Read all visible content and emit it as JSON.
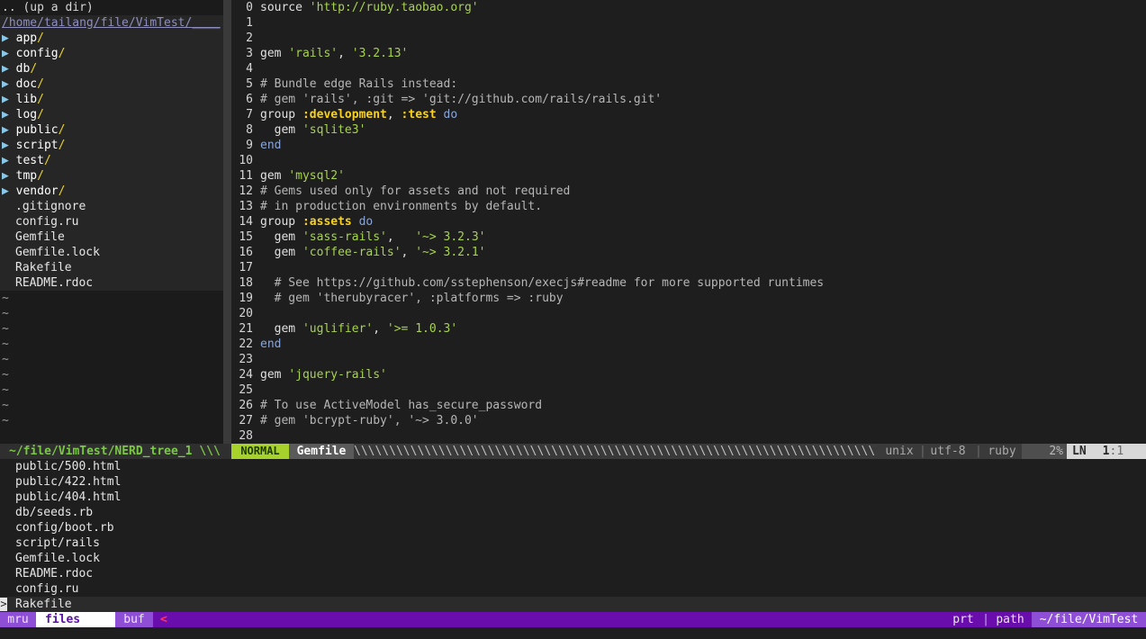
{
  "nerdtree": {
    "up_dir": ".. (up a dir)",
    "root_path": "/home/tailang/file/VimTest/",
    "dirs": [
      "app",
      "config",
      "db",
      "doc",
      "lib",
      "log",
      "public",
      "script",
      "test",
      "tmp",
      "vendor"
    ],
    "files": [
      ".gitignore",
      "config.ru",
      "Gemfile",
      "Gemfile.lock",
      "Rakefile",
      "README.rdoc"
    ],
    "arrow": "▶",
    "slash": "/",
    "tilde": "~"
  },
  "editor": {
    "lines": [
      {
        "n": "0",
        "parts": [
          [
            "plain",
            "source "
          ],
          [
            "str",
            "'http://ruby.taobao.org'"
          ]
        ]
      },
      {
        "n": "1",
        "parts": []
      },
      {
        "n": "2",
        "parts": []
      },
      {
        "n": "3",
        "parts": [
          [
            "plain",
            "gem "
          ],
          [
            "str",
            "'rails'"
          ],
          [
            "plain",
            ", "
          ],
          [
            "str",
            "'3.2.13'"
          ]
        ]
      },
      {
        "n": "4",
        "parts": []
      },
      {
        "n": "5",
        "parts": [
          [
            "cmt",
            "# Bundle edge Rails instead:"
          ]
        ]
      },
      {
        "n": "6",
        "parts": [
          [
            "cmt",
            "# gem 'rails', :git => 'git://github.com/rails/rails.git'"
          ]
        ]
      },
      {
        "n": "7",
        "parts": [
          [
            "plain",
            "group "
          ],
          [
            "sym",
            ":development"
          ],
          [
            "plain",
            ", "
          ],
          [
            "sym",
            ":test"
          ],
          [
            "plain",
            " "
          ],
          [
            "kw",
            "do"
          ]
        ]
      },
      {
        "n": "8",
        "parts": [
          [
            "plain",
            "  gem "
          ],
          [
            "str",
            "'sqlite3'"
          ]
        ]
      },
      {
        "n": "9",
        "parts": [
          [
            "kw",
            "end"
          ]
        ]
      },
      {
        "n": "10",
        "parts": []
      },
      {
        "n": "11",
        "parts": [
          [
            "plain",
            "gem "
          ],
          [
            "str",
            "'mysql2'"
          ]
        ]
      },
      {
        "n": "12",
        "parts": [
          [
            "cmt",
            "# Gems used only for assets and not required"
          ]
        ]
      },
      {
        "n": "13",
        "parts": [
          [
            "cmt",
            "# in production environments by default."
          ]
        ]
      },
      {
        "n": "14",
        "parts": [
          [
            "plain",
            "group "
          ],
          [
            "sym",
            ":assets"
          ],
          [
            "plain",
            " "
          ],
          [
            "kw",
            "do"
          ]
        ]
      },
      {
        "n": "15",
        "parts": [
          [
            "plain",
            "  gem "
          ],
          [
            "str",
            "'sass-rails'"
          ],
          [
            "plain",
            ",   "
          ],
          [
            "str",
            "'~> 3.2.3'"
          ]
        ]
      },
      {
        "n": "16",
        "parts": [
          [
            "plain",
            "  gem "
          ],
          [
            "str",
            "'coffee-rails'"
          ],
          [
            "plain",
            ", "
          ],
          [
            "str",
            "'~> 3.2.1'"
          ]
        ]
      },
      {
        "n": "17",
        "parts": []
      },
      {
        "n": "18",
        "parts": [
          [
            "cmt",
            "  # See https://github.com/sstephenson/execjs#readme for more supported runtimes"
          ]
        ]
      },
      {
        "n": "19",
        "parts": [
          [
            "cmt",
            "  # gem 'therubyracer', :platforms => :ruby"
          ]
        ]
      },
      {
        "n": "20",
        "parts": []
      },
      {
        "n": "21",
        "parts": [
          [
            "plain",
            "  gem "
          ],
          [
            "str",
            "'uglifier'"
          ],
          [
            "plain",
            ", "
          ],
          [
            "str",
            "'>= 1.0.3'"
          ]
        ]
      },
      {
        "n": "22",
        "parts": [
          [
            "kw",
            "end"
          ]
        ]
      },
      {
        "n": "23",
        "parts": []
      },
      {
        "n": "24",
        "parts": [
          [
            "plain",
            "gem "
          ],
          [
            "str",
            "'jquery-rails'"
          ]
        ]
      },
      {
        "n": "25",
        "parts": []
      },
      {
        "n": "26",
        "parts": [
          [
            "cmt",
            "# To use ActiveModel has_secure_password"
          ]
        ]
      },
      {
        "n": "27",
        "parts": [
          [
            "cmt",
            "# gem 'bcrypt-ruby', '~> 3.0.0'"
          ]
        ]
      },
      {
        "n": "28",
        "parts": []
      }
    ]
  },
  "statusline": {
    "nerd_buffer": "~/file/VimTest/NERD_tree_1 \\\\\\",
    "mode": "NORMAL",
    "filename": "Gemfile",
    "fill": "\\\\\\\\\\\\\\\\\\\\\\\\\\\\\\\\\\\\\\\\\\\\\\\\\\\\\\\\\\\\\\\\\\\\\\\\\\\\\\\\\\\\\\\\\\\\\\\\\\\\\\\\\\\\\\\\\\\\\\\\\\\\\\\\\\\\\\\\\\\\\\\\\\\\\\\\\\\\",
    "fileformat": "unix",
    "encoding": "utf-8",
    "filetype": "ruby",
    "percent": "2%",
    "ln_label": "LN",
    "line": "1",
    "col": "1"
  },
  "ctrlp": {
    "items": [
      "public/500.html",
      "public/422.html",
      "public/404.html",
      "db/seeds.rb",
      "config/boot.rb",
      "script/rails",
      "Gemfile.lock",
      "README.rdoc",
      "config.ru",
      "Rakefile"
    ],
    "selected_marker": ">",
    "status": {
      "mru": "mru",
      "files": "files",
      "buf": "buf",
      "arrow": "<",
      "prt": "prt",
      "sep": "|",
      "path": "path",
      "dir": "~/file/VimTest"
    }
  },
  "colors": {
    "mode_bg": "#a6d22b",
    "ctrlp_bar": "#6a0dad",
    "string": "#a7d34d",
    "symbol": "#f8d21c"
  }
}
